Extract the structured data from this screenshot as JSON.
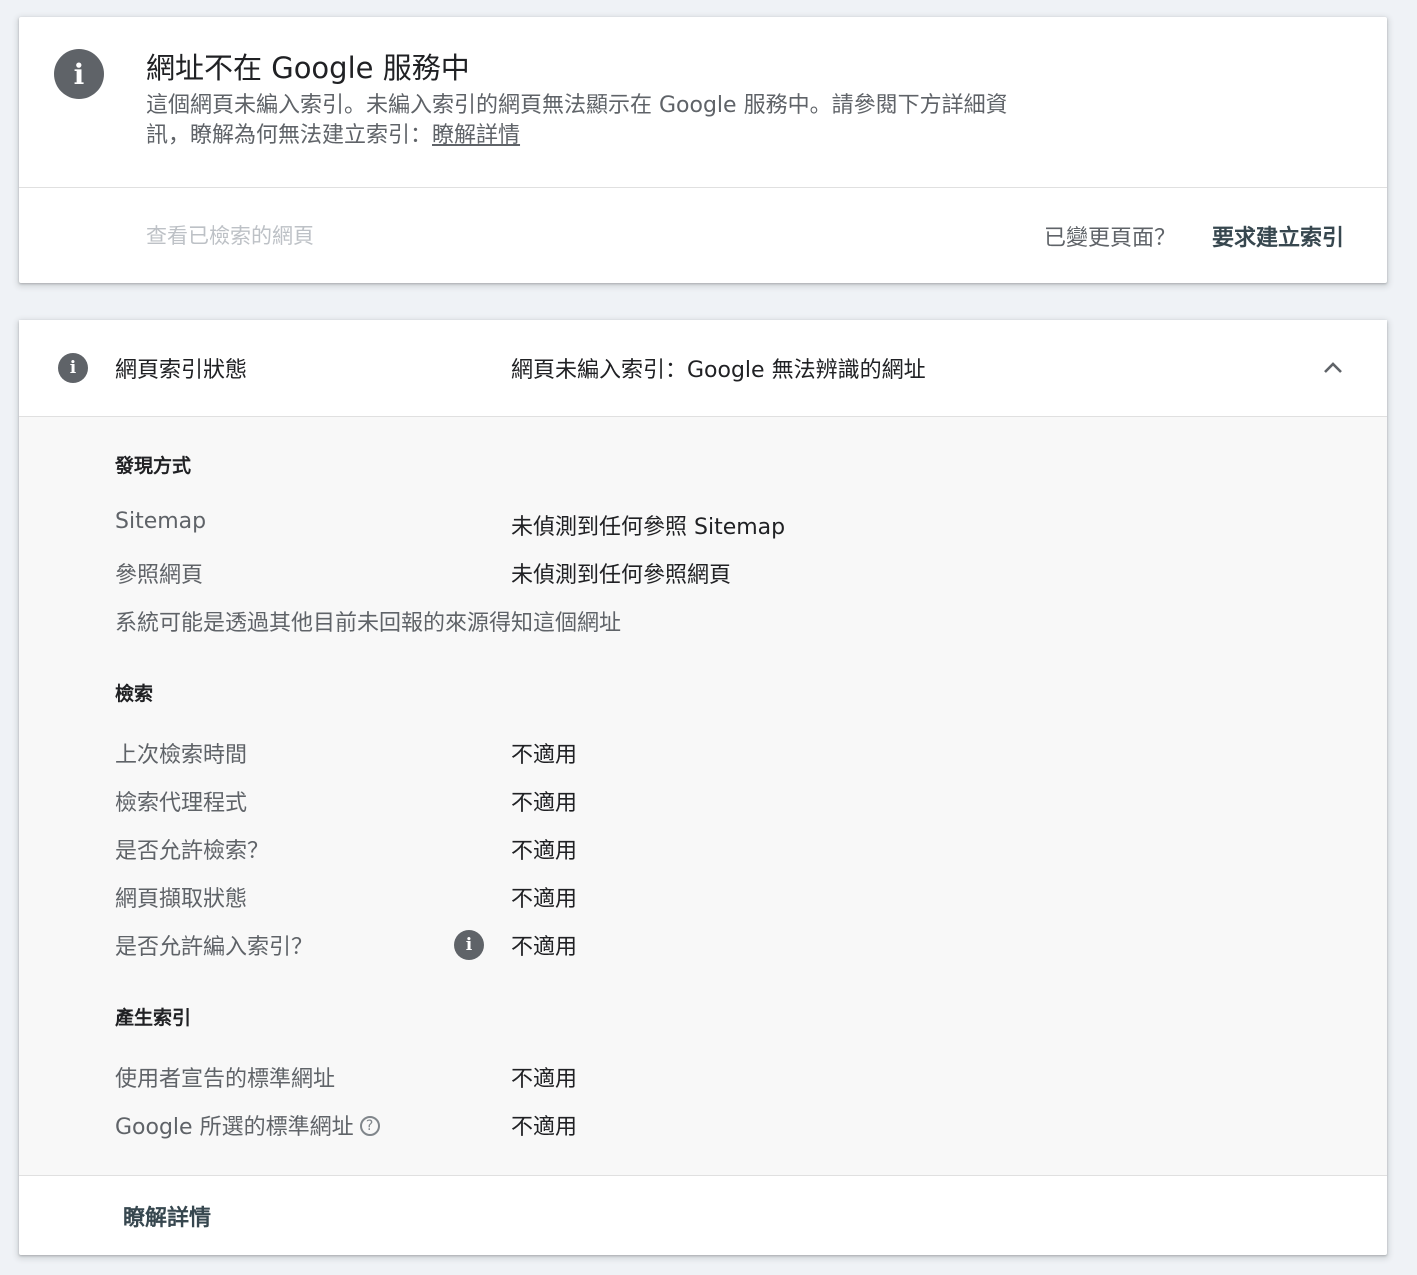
{
  "status_card": {
    "icon": "info-icon",
    "title": "網址不在 Google 服務中",
    "description": "這個網頁未編入索引。未編入索引的網頁無法顯示在 Google 服務中。請參閱下方詳細資訊，瞭解為何無法建立索引：",
    "learn_more_link": "瞭解詳情",
    "view_crawled_page": "查看已檢索的網頁",
    "changed_page_question": "已變更頁面？",
    "request_indexing": "要求建立索引"
  },
  "indexing_card": {
    "header": {
      "icon": "info-icon",
      "label": "網頁索引狀態",
      "value": "網頁未編入索引：Google 無法辨識的網址",
      "toggle_icon": "chevron-up-icon"
    },
    "discovery": {
      "title": "發現方式",
      "rows": [
        {
          "label": "Sitemap",
          "value": "未偵測到任何參照 Sitemap"
        },
        {
          "label": "參照網頁",
          "value": "未偵測到任何參照網頁"
        }
      ],
      "note": "系統可能是透過其他目前未回報的來源得知這個網址"
    },
    "crawl": {
      "title": "檢索",
      "rows": [
        {
          "label": "上次檢索時間",
          "value": "不適用"
        },
        {
          "label": "檢索代理程式",
          "value": "不適用"
        },
        {
          "label": "是否允許檢索？",
          "value": "不適用"
        },
        {
          "label": "網頁擷取狀態",
          "value": "不適用"
        },
        {
          "label": "是否允許編入索引？",
          "value": "不適用"
        }
      ]
    },
    "indexing": {
      "title": "產生索引",
      "rows": [
        {
          "label": "使用者宣告的標準網址",
          "value": "不適用"
        },
        {
          "label": "Google 所選的標準網址",
          "value": "不適用"
        }
      ]
    },
    "footer_link": "瞭解詳情"
  }
}
